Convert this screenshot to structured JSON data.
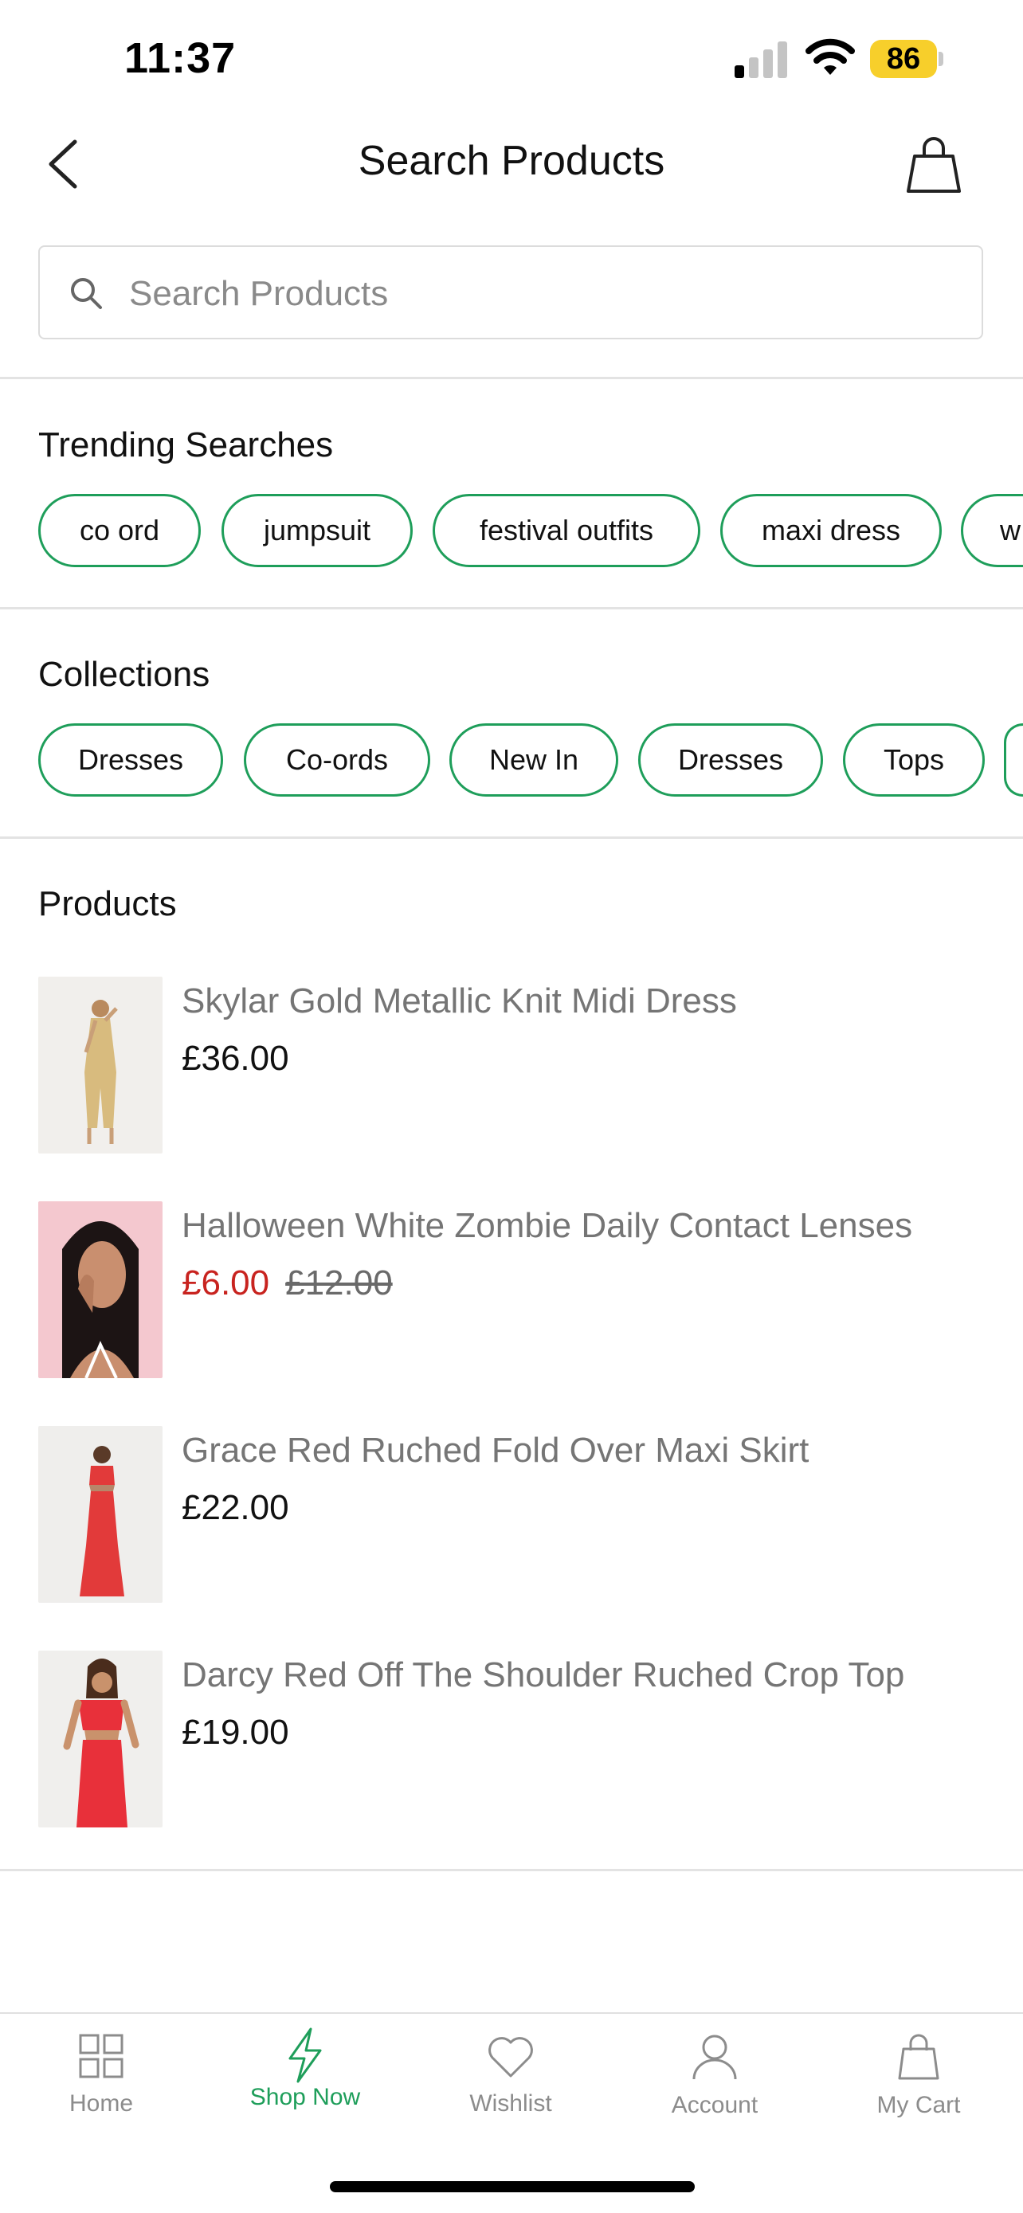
{
  "status_bar": {
    "time": "11:37",
    "battery": "86"
  },
  "header": {
    "title": "Search Products"
  },
  "search": {
    "placeholder": "Search Products",
    "value": ""
  },
  "trending": {
    "title": "Trending Searches",
    "chips": [
      "co ord",
      "jumpsuit",
      "festival outfits",
      "maxi dress",
      "w"
    ]
  },
  "collections": {
    "title": "Collections",
    "chips": [
      "Dresses",
      "Co-ords",
      "New In",
      "Dresses",
      "Tops"
    ]
  },
  "products": {
    "title": "Products",
    "items": [
      {
        "name": "Skylar Gold Metallic Knit Midi Dress",
        "price": "£36.00"
      },
      {
        "name": "Halloween White Zombie Daily Contact Lenses",
        "price": "£6.00",
        "old_price": "£12.00"
      },
      {
        "name": "Grace Red Ruched Fold Over Maxi Skirt",
        "price": "£22.00"
      },
      {
        "name": "Darcy Red Off The Shoulder Ruched Crop Top",
        "price": "£19.00"
      }
    ]
  },
  "tabbar": {
    "items": [
      {
        "label": "Home",
        "icon": "grid-icon"
      },
      {
        "label": "Shop Now",
        "icon": "lightning-icon",
        "active": true
      },
      {
        "label": "Wishlist",
        "icon": "heart-icon"
      },
      {
        "label": "Account",
        "icon": "user-icon"
      },
      {
        "label": "My Cart",
        "icon": "bag-icon"
      }
    ]
  },
  "colors": {
    "accent": "#1e9e5a",
    "sale": "#c8231f",
    "battery": "#f7cf2b"
  }
}
